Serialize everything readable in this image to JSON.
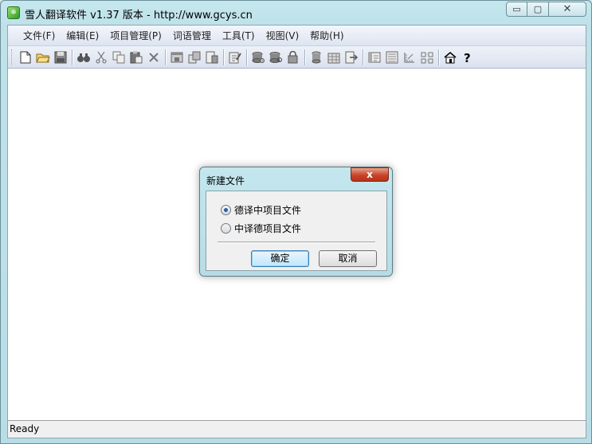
{
  "window": {
    "title": "雪人翻译软件 v1.37 版本 - http://www.gcys.cn",
    "controls": {
      "minimize": "▭",
      "maximize": "▢",
      "close": "✕"
    }
  },
  "menubar": {
    "items": [
      "文件(F)",
      "编辑(E)",
      "项目管理(P)",
      "词语管理",
      "工具(T)",
      "视图(V)",
      "帮助(H)"
    ]
  },
  "toolbar": {
    "groups": [
      [
        "new-file-icon",
        "open-folder-icon",
        "save-icon"
      ],
      [
        "find-icon",
        "cut-icon",
        "copy-icon",
        "paste-icon",
        "delete-icon"
      ],
      [
        "window-icon",
        "stack-icon",
        "doc-icon"
      ],
      [
        "edit-icon"
      ],
      [
        "db-settings-icon",
        "db-refresh-icon",
        "db-lock-icon"
      ],
      [
        "cylinder-icon",
        "grid-icon",
        "export-icon"
      ],
      [
        "panel-icon",
        "list-icon",
        "ruler-icon",
        "split-icon"
      ],
      [
        "home-icon",
        "help-icon"
      ]
    ]
  },
  "status": {
    "text": "Ready"
  },
  "dialog": {
    "title": "新建文件",
    "close": "x",
    "options": [
      {
        "label": "德译中项目文件",
        "checked": true
      },
      {
        "label": "中译德项目文件",
        "checked": false
      }
    ],
    "ok_label": "确定",
    "cancel_label": "取消"
  }
}
